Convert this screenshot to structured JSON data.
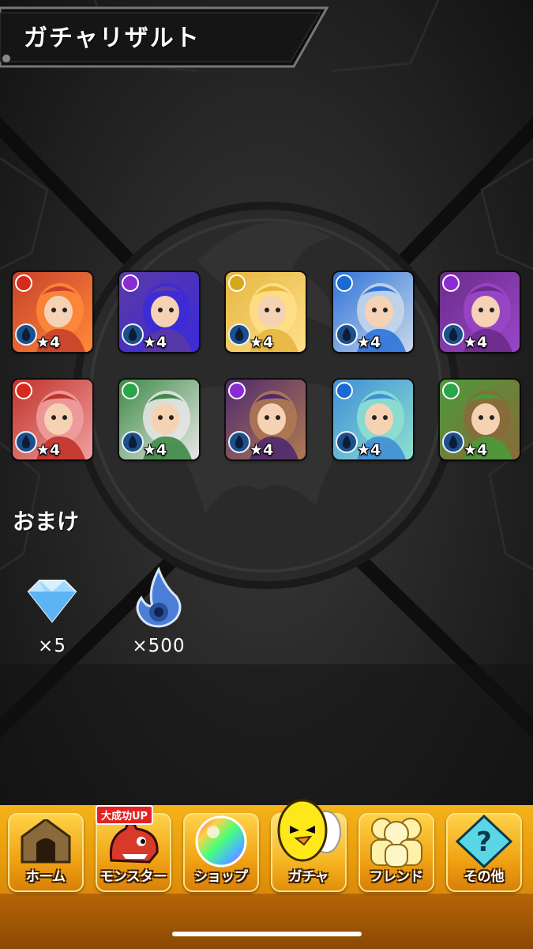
{
  "header": {
    "title": "ガチャリザルト"
  },
  "monsters": [
    {
      "element": "fire",
      "element_color": "#d62a1a",
      "bg": "#c8412a",
      "accent": "#ff8a3a",
      "rarity": "★4"
    },
    {
      "element": "dark",
      "element_color": "#8a2bd6",
      "bg": "#5a3aa6",
      "accent": "#3b2ad8",
      "rarity": "★4"
    },
    {
      "element": "light",
      "element_color": "#d6a81a",
      "bg": "#e6b640",
      "accent": "#ffe08a",
      "rarity": "★4"
    },
    {
      "element": "water",
      "element_color": "#1a6ad6",
      "bg": "#2f73d9",
      "accent": "#c9d8ea",
      "rarity": "★4"
    },
    {
      "element": "dark",
      "element_color": "#8a2bd6",
      "bg": "#6b2c8a",
      "accent": "#9a46c8",
      "rarity": "★4"
    },
    {
      "element": "fire",
      "element_color": "#d62a1a",
      "bg": "#c0332a",
      "accent": "#f0a0a0",
      "rarity": "★4"
    },
    {
      "element": "wood",
      "element_color": "#2aa64a",
      "bg": "#3e8a46",
      "accent": "#e8e8e8",
      "rarity": "★4"
    },
    {
      "element": "dark",
      "element_color": "#8a2bd6",
      "bg": "#4f2a6e",
      "accent": "#b07a52",
      "rarity": "★4"
    },
    {
      "element": "water",
      "element_color": "#1a6ad6",
      "bg": "#3f8fd6",
      "accent": "#8fe0d0",
      "rarity": "★4"
    },
    {
      "element": "wood",
      "element_color": "#2aa64a",
      "bg": "#4c9a3a",
      "accent": "#8a6a3a",
      "rarity": "★4"
    }
  ],
  "bonus": {
    "title": "おまけ",
    "items": [
      {
        "icon": "diamond-icon",
        "count": "×5"
      },
      {
        "icon": "soul-flame-icon",
        "count": "×500"
      }
    ]
  },
  "nav": {
    "items": [
      {
        "label": "ホーム",
        "icon": "home-icon"
      },
      {
        "label": "モンスター",
        "icon": "monster-icon",
        "badge": "大成功UP"
      },
      {
        "label": "ショップ",
        "icon": "shop-orb-icon"
      },
      {
        "label": "ガチャ",
        "icon": "gacha-egg-icon"
      },
      {
        "label": "フレンド",
        "icon": "friend-icon"
      },
      {
        "label": "その他",
        "icon": "other-icon"
      }
    ]
  }
}
